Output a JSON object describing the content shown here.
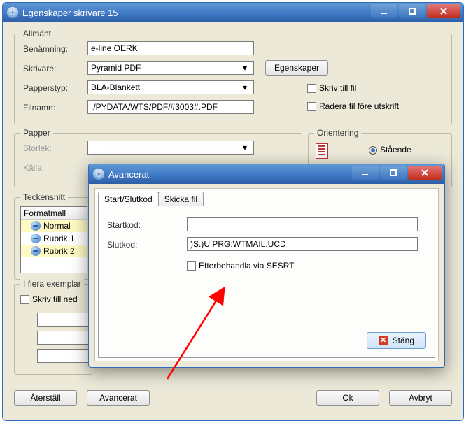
{
  "mainWindow": {
    "title": "Egenskaper skrivare 15",
    "groupGeneral": {
      "legend": "Allmänt",
      "labels": {
        "name": "Benämning:",
        "printer": "Skrivare:",
        "paperType": "Papperstyp:",
        "filename": "Filnamn:"
      },
      "values": {
        "name": "e-line OERK",
        "printer": "Pyramid PDF",
        "paperType": "BLA-Blankett",
        "filename": "./PYDATA/WTS/PDF/#3003#.PDF"
      },
      "buttons": {
        "properties": "Egenskaper"
      },
      "checks": {
        "writeToFile": "Skriv till fil",
        "deleteBefore": "Radera fil före utskrift"
      }
    },
    "groupPaper": {
      "legend": "Papper",
      "labels": {
        "size": "Storlek:",
        "source": "Källa:"
      }
    },
    "groupOrient": {
      "legend": "Orientering",
      "options": {
        "portrait": "Stående"
      }
    },
    "groupFont": {
      "legend": "Teckensnitt",
      "header": "Formatmall",
      "rows": [
        "Normal",
        "Rubrik 1",
        "Rubrik 2"
      ]
    },
    "groupCopies": {
      "legend": "I flera exemplar",
      "check": "Skriv till ned"
    },
    "buttons": {
      "reset": "Återställ",
      "advanced": "Avancerat",
      "ok": "Ok",
      "cancel": "Avbryt"
    }
  },
  "modal": {
    "title": "Avancerat",
    "tabs": {
      "startstop": "Start/Slutkod",
      "send": "Skicka fil"
    },
    "labels": {
      "start": "Startkod:",
      "end": "Slutkod:"
    },
    "values": {
      "start": "",
      "end": ")S.)U PRG:WTMAIL.UCD"
    },
    "check": "Efterbehandla via SESRT",
    "close": "Stäng"
  }
}
